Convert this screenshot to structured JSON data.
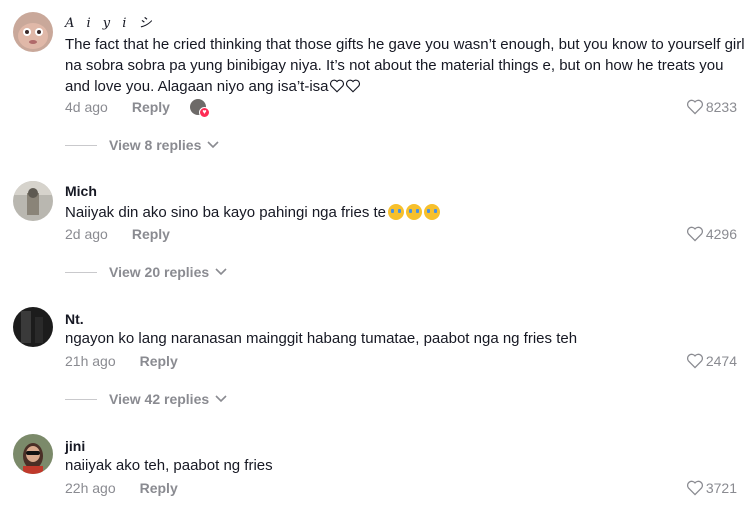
{
  "comments": [
    {
      "username": "A i y i シ",
      "text": "The fact that he cried thinking that those gifts he gave you wasn’t enough, but you know to yourself girl na sobra sobra pa yung binibigay niya. It’s not about the material things e, but on how he treats you and love you. Alagaan niyo ang isa’t-isa",
      "time": "4d ago",
      "reply": "Reply",
      "likes": "8233",
      "view_replies": "View 8 replies"
    },
    {
      "username": "Mich",
      "text": "Naiiyak din ako sino ba kayo pahingi nga fries te",
      "time": "2d ago",
      "reply": "Reply",
      "likes": "4296",
      "view_replies": "View 20 replies"
    },
    {
      "username": "Nt.",
      "text": "ngayon ko lang naranasan mainggit habang tumatae, paabot nga ng fries teh",
      "time": "21h ago",
      "reply": "Reply",
      "likes": "2474",
      "view_replies": "View 42 replies"
    },
    {
      "username": "jini",
      "text": "naiiyak ako teh, paabot ng fries",
      "time": "22h ago",
      "reply": "Reply",
      "likes": "3721"
    }
  ],
  "icons": {
    "like": "heart-outline-icon",
    "chevron": "chevron-down-icon",
    "emoji": "loudly-crying-face-emoji"
  }
}
